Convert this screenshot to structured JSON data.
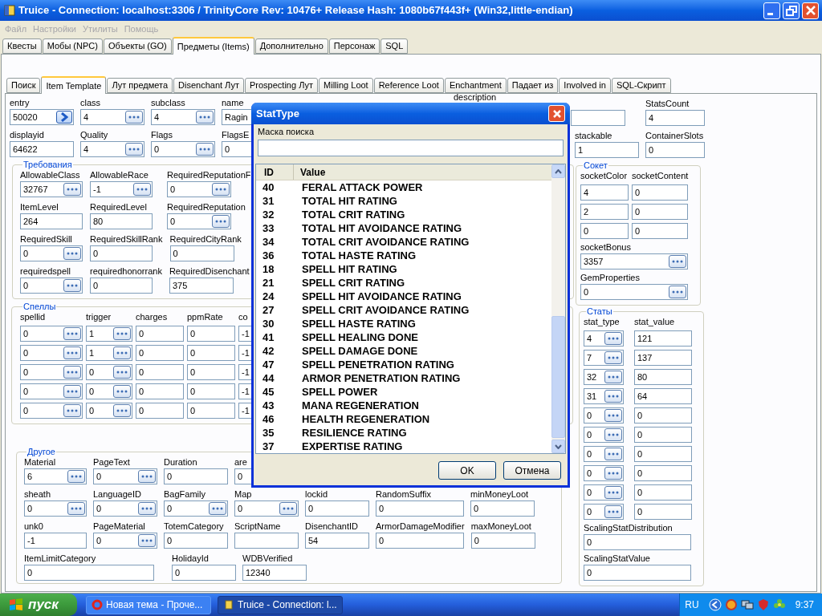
{
  "window": {
    "title": "Truice - Connection: localhost:3306 / TrinityCore Rev: 10476+ Release Hash: 1080b67f443f+ (Win32,little-endian)"
  },
  "menu": [
    {
      "label": "Файл",
      "disabled": true
    },
    {
      "label": "Настройки",
      "disabled": true
    },
    {
      "label": "Утилиты",
      "disabled": true
    },
    {
      "label": "Помощь",
      "disabled": true
    }
  ],
  "main_tabs": [
    {
      "label": "Квесты",
      "selected": false
    },
    {
      "label": "Мобы (NPC)",
      "selected": false
    },
    {
      "label": "Объекты (GO)",
      "selected": false
    },
    {
      "label": "Предметы (Items)",
      "selected": true
    },
    {
      "label": "Дополнительно",
      "selected": false
    },
    {
      "label": "Персонаж",
      "selected": false
    },
    {
      "label": "SQL",
      "selected": false
    }
  ],
  "sub_tabs": [
    {
      "label": "Поиск",
      "selected": false
    },
    {
      "label": "Item Template",
      "selected": true
    },
    {
      "label": "Лут предмета",
      "selected": false
    },
    {
      "label": "Disenchant Лут",
      "selected": false
    },
    {
      "label": "Prospecting Лут",
      "selected": false
    },
    {
      "label": "Milling Loot",
      "selected": false
    },
    {
      "label": "Reference Loot",
      "selected": false
    },
    {
      "label": "Enchantment",
      "selected": false
    },
    {
      "label": "Падает из",
      "selected": false
    },
    {
      "label": "Involved in",
      "selected": false
    },
    {
      "label": "SQL-Скрипт",
      "selected": false
    }
  ],
  "header_fields": [
    [
      {
        "label": "entry",
        "value": "50020",
        "kind": "go"
      },
      {
        "label": "class",
        "value": "4",
        "kind": "lookup"
      },
      {
        "label": "subclass",
        "value": "4",
        "kind": "lookup"
      },
      {
        "label": "name",
        "value": "Ragin",
        "kind": "text"
      }
    ],
    [
      {
        "label": "displayid",
        "value": "64622",
        "kind": "text"
      },
      {
        "label": "Quality",
        "value": "4",
        "kind": "lookup"
      },
      {
        "label": "Flags",
        "value": "0",
        "kind": "lookup"
      },
      {
        "label": "FlagsE",
        "value": "0",
        "kind": "text"
      }
    ]
  ],
  "description_label": "description",
  "right_header": [
    [
      {
        "label": "StatsCount",
        "value": "4"
      }
    ],
    [
      {
        "label": "stackable",
        "value": "1"
      },
      {
        "label": "ContainerSlots",
        "value": "0"
      }
    ]
  ],
  "requirements": {
    "title": "Требования",
    "rows": [
      [
        {
          "label": "AllowableClass",
          "value": "32767",
          "kind": "lookup"
        },
        {
          "label": "AllowableRace",
          "value": "-1",
          "kind": "lookup"
        },
        {
          "label": "RequiredReputationF",
          "value": "0",
          "kind": "lookup"
        }
      ],
      [
        {
          "label": "ItemLevel",
          "value": "264",
          "kind": "text"
        },
        {
          "label": "RequiredLevel",
          "value": "80",
          "kind": "text"
        },
        {
          "label": "RequiredReputation",
          "value": "0",
          "kind": "lookup"
        }
      ],
      [
        {
          "label": "RequiredSkill",
          "value": "0",
          "kind": "lookup"
        },
        {
          "label": "RequiredSkillRank",
          "value": "0",
          "kind": "text"
        },
        {
          "label": "RequiredCityRank",
          "value": "0",
          "kind": "text"
        }
      ],
      [
        {
          "label": "requiredspell",
          "value": "0",
          "kind": "lookup"
        },
        {
          "label": "requiredhonorrank",
          "value": "0",
          "kind": "text"
        },
        {
          "label": "RequiredDisenchant",
          "value": "375",
          "kind": "text"
        }
      ]
    ]
  },
  "spells": {
    "title": "Спеллы",
    "columns": [
      {
        "label": "spellid",
        "kind": "lookup"
      },
      {
        "label": "trigger",
        "kind": "lookup"
      },
      {
        "label": "charges",
        "kind": "text"
      },
      {
        "label": "ppmRate",
        "kind": "text"
      },
      {
        "label": "co",
        "kind": "text"
      }
    ],
    "rows": [
      [
        "0",
        "1",
        "0",
        "0",
        "-1"
      ],
      [
        "0",
        "1",
        "0",
        "0",
        "-1"
      ],
      [
        "0",
        "0",
        "0",
        "0",
        "-1"
      ],
      [
        "0",
        "0",
        "0",
        "0",
        "-1"
      ],
      [
        "0",
        "0",
        "0",
        "0",
        "-1"
      ]
    ]
  },
  "other": {
    "title": "Другое",
    "fields": [
      {
        "label": "Material",
        "value": "6",
        "kind": "lookup"
      },
      {
        "label": "PageText",
        "value": "0",
        "kind": "lookup"
      },
      {
        "label": "Duration",
        "value": "0",
        "kind": "text"
      },
      {
        "label": "are",
        "value": "0",
        "kind": "text"
      },
      {
        "label": "sheath",
        "value": "0",
        "kind": "lookup"
      },
      {
        "label": "LanguageID",
        "value": "0",
        "kind": "lookup"
      },
      {
        "label": "BagFamily",
        "value": "0",
        "kind": "lookup"
      },
      {
        "label": "Map",
        "value": "0",
        "kind": "lookup"
      },
      {
        "label": "lockid",
        "value": "0",
        "kind": "text"
      },
      {
        "label": "RandomSuffix",
        "value": "0",
        "kind": "text"
      },
      {
        "label": "minMoneyLoot",
        "value": "0",
        "kind": "text"
      },
      {
        "label": "unk0",
        "value": "-1",
        "kind": "text"
      },
      {
        "label": "PageMaterial",
        "value": "0",
        "kind": "lookup"
      },
      {
        "label": "TotemCategory",
        "value": "0",
        "kind": "text"
      },
      {
        "label": "ScriptName",
        "kind": "text"
      },
      {
        "label": "DisenchantID",
        "value": "54",
        "kind": "text"
      },
      {
        "label": "ArmorDamageModifier",
        "value": "0",
        "kind": "text"
      },
      {
        "label": "maxMoneyLoot",
        "value": "0",
        "kind": "text"
      },
      {
        "label": "ItemLimitCategory",
        "value": "0",
        "kind": "text"
      },
      {
        "label": "HolidayId",
        "value": "0",
        "kind": "text"
      },
      {
        "label": "WDBVerified",
        "value": "12340",
        "kind": "text"
      }
    ]
  },
  "socket": {
    "title": "Сокет",
    "columns": [
      "socketColor",
      "socketContent"
    ],
    "rows": [
      [
        "4",
        "0"
      ],
      [
        "2",
        "0"
      ],
      [
        "0",
        "0"
      ]
    ],
    "fields": [
      {
        "label": "socketBonus",
        "value": "3357",
        "kind": "lookup"
      },
      {
        "label": "GemProperties",
        "value": "0",
        "kind": "lookup"
      }
    ]
  },
  "stats": {
    "title": "Статы",
    "columns": [
      {
        "label": "stat_type",
        "kind": "lookup"
      },
      {
        "label": "stat_value",
        "kind": "text"
      }
    ],
    "rows": [
      [
        "4",
        "121"
      ],
      [
        "7",
        "137"
      ],
      [
        "32",
        "80"
      ],
      [
        "31",
        "64"
      ],
      [
        "0",
        "0"
      ],
      [
        "0",
        "0"
      ],
      [
        "0",
        "0"
      ],
      [
        "0",
        "0"
      ],
      [
        "0",
        "0"
      ],
      [
        "0",
        "0"
      ]
    ],
    "fields": [
      {
        "label": "ScalingStatDistribution",
        "value": "0"
      },
      {
        "label": "ScalingStatValue",
        "value": "0"
      }
    ]
  },
  "dialog": {
    "title": "StatType",
    "search_label": "Маска поиска",
    "columns": [
      "ID",
      "Value"
    ],
    "rows": [
      {
        "id": "40",
        "value": "FERAL ATTACK POWER",
        "selected": false
      },
      {
        "id": "31",
        "value": "TOTAL HIT RATING",
        "selected": false
      },
      {
        "id": "32",
        "value": "TOTAL CRIT RATING",
        "selected": false
      },
      {
        "id": "33",
        "value": "TOTAL HIT AVOIDANCE RATING",
        "selected": false
      },
      {
        "id": "34",
        "value": "TOTAL CRIT AVOIDANCE RATING",
        "selected": false
      },
      {
        "id": "36",
        "value": "TOTAL HASTE RATING",
        "selected": false
      },
      {
        "id": "18",
        "value": "SPELL HIT RATING",
        "selected": false
      },
      {
        "id": "21",
        "value": "SPELL CRIT RATING",
        "selected": false
      },
      {
        "id": "24",
        "value": "SPELL HIT AVOIDANCE RATING",
        "selected": false
      },
      {
        "id": "27",
        "value": "SPELL CRIT AVOIDANCE RATING",
        "selected": false
      },
      {
        "id": "30",
        "value": "SPELL HASTE RATING",
        "selected": false
      },
      {
        "id": "41",
        "value": "SPELL HEALING DONE",
        "selected": false
      },
      {
        "id": "42",
        "value": "SPELL DAMAGE DONE",
        "selected": false
      },
      {
        "id": "47",
        "value": "SPELL PENETRATION RATING",
        "selected": false
      },
      {
        "id": "44",
        "value": "ARMOR PENETRATION RATING",
        "selected": false
      },
      {
        "id": "45",
        "value": "SPELL POWER",
        "selected": false
      },
      {
        "id": "43",
        "value": "MANA REGENERATION",
        "selected": false
      },
      {
        "id": "46",
        "value": "HEALTH REGENERATION",
        "selected": false
      },
      {
        "id": "35",
        "value": "RESILIENCE RATING",
        "selected": false
      },
      {
        "id": "37",
        "value": "EXPERTISE RATING",
        "selected": false
      }
    ],
    "buttons": [
      "OK",
      "Отмена"
    ]
  },
  "taskbar": {
    "start": "пуск",
    "tasks": [
      {
        "label": "Новая тема - Проче...",
        "selected": false
      },
      {
        "label": "Truice - Connection: l...",
        "selected": true
      }
    ],
    "language": "RU",
    "clock": "9:37"
  }
}
